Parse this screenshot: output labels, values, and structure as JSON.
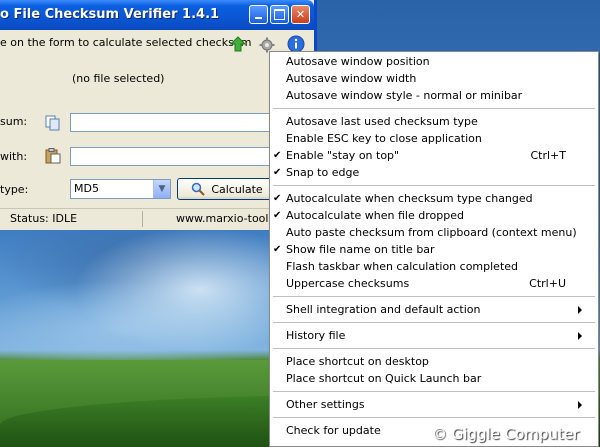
{
  "window": {
    "title": "o File Checksum Verifier 1.4.1",
    "hint": "e on the form to calculate selected checksum",
    "no_file": "(no file selected)",
    "checksum_label": "sum:",
    "compare_label": "with:",
    "type_label": "type:",
    "checksum_type": "MD5",
    "calculate_label": "Calculate",
    "status": "Status: IDLE",
    "website": "www.marxio-tools."
  },
  "menu": {
    "items": [
      {
        "label": "Autosave window position",
        "checked": false
      },
      {
        "label": "Autosave window width",
        "checked": false
      },
      {
        "label": "Autosave window style - normal or minibar",
        "checked": false
      },
      {
        "label": "Autosave last used checksum type",
        "checked": false
      },
      {
        "label": "Enable ESC key to close application",
        "checked": false
      },
      {
        "label": "Enable \"stay on top\"",
        "checked": true,
        "shortcut": "Ctrl+T"
      },
      {
        "label": "Snap to edge",
        "checked": true
      },
      {
        "label": "Autocalculate when checksum type changed",
        "checked": true
      },
      {
        "label": "Autocalculate when file dropped",
        "checked": true
      },
      {
        "label": "Auto paste checksum from clipboard (context menu)",
        "checked": false
      },
      {
        "label": "Show file name on title bar",
        "checked": true
      },
      {
        "label": "Flash taskbar when calculation completed",
        "checked": false
      },
      {
        "label": "Uppercase checksums",
        "checked": false,
        "shortcut": "Ctrl+U"
      },
      {
        "label": "Shell integration and default action",
        "submenu": true
      },
      {
        "label": "History file",
        "submenu": true
      },
      {
        "label": "Place shortcut on desktop"
      },
      {
        "label": "Place shortcut on Quick Launch bar"
      },
      {
        "label": "Other settings",
        "submenu": true
      },
      {
        "label": "Check for update"
      }
    ],
    "check_glyph": "✔"
  },
  "watermark": "© Giggle Computer",
  "icons": {
    "arrow": "green-up-arrow-icon",
    "gear": "gear-icon",
    "info": "info-icon",
    "copy": "copy-icon",
    "paste": "paste-icon",
    "search": "magnifier-icon"
  },
  "colors": {
    "titlebar": "#0b56d2",
    "accent": "#0a48c8"
  }
}
